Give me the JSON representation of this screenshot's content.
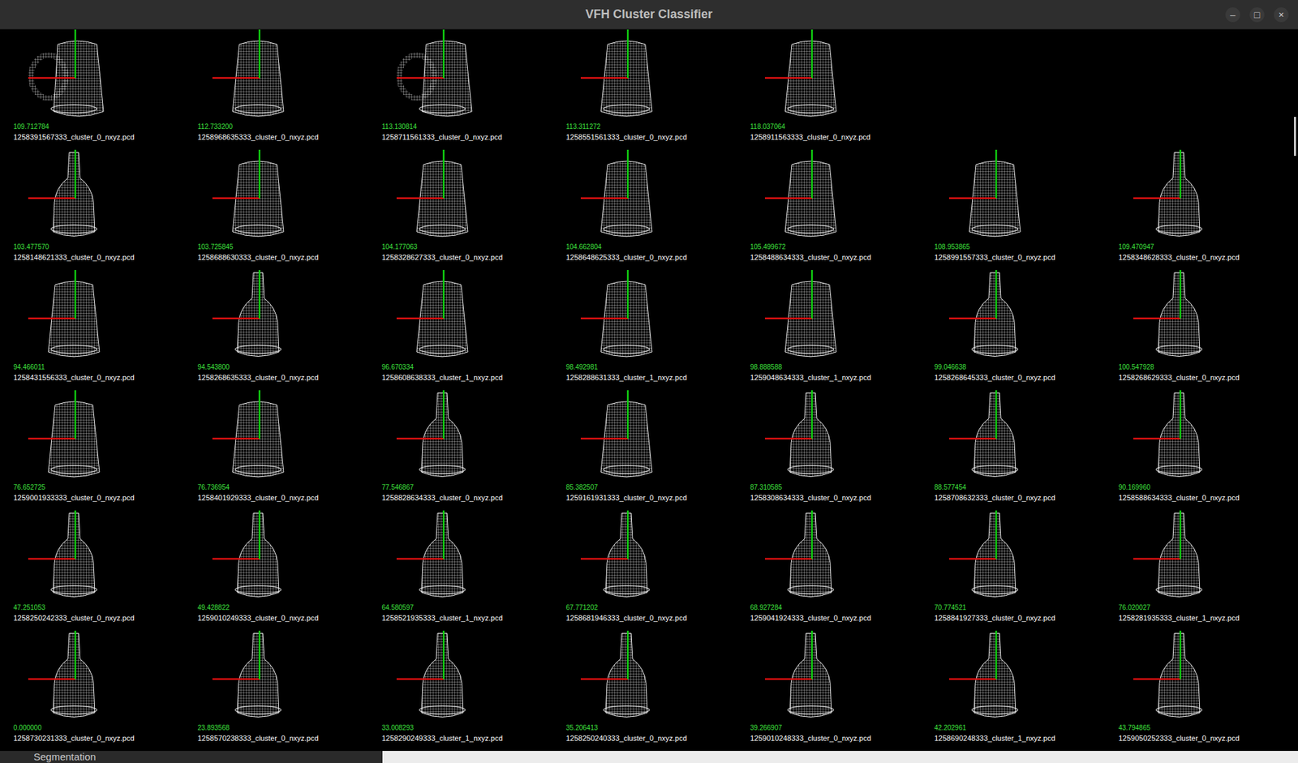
{
  "window": {
    "title": "VFH Cluster Classifier",
    "controls": [
      "–",
      "□",
      "×"
    ]
  },
  "results": [
    [
      {
        "score": "109.712784",
        "file": "1258391567333_cluster_0_nxyz.pcd",
        "kind": "mug"
      },
      {
        "score": "112.733200",
        "file": "1258968635333_cluster_0_nxyz.pcd",
        "kind": "box"
      },
      {
        "score": "113.130814",
        "file": "1258711561333_cluster_0_nxyz.pcd",
        "kind": "mug"
      },
      {
        "score": "113.311272",
        "file": "1258551561333_cluster_0_nxyz.pcd",
        "kind": "box"
      },
      {
        "score": "118.037064",
        "file": "1258911563333_cluster_0_nxyz.pcd",
        "kind": "box"
      }
    ],
    [
      {
        "score": "103.477570",
        "file": "1258148621333_cluster_0_nxyz.pcd",
        "kind": "bottle"
      },
      {
        "score": "103.725845",
        "file": "1258688630333_cluster_0_nxyz.pcd",
        "kind": "box"
      },
      {
        "score": "104.177063",
        "file": "1258328627333_cluster_0_nxyz.pcd",
        "kind": "box"
      },
      {
        "score": "104.662804",
        "file": "1258648625333_cluster_0_nxyz.pcd",
        "kind": "box"
      },
      {
        "score": "105.499672",
        "file": "1258488634333_cluster_0_nxyz.pcd",
        "kind": "box"
      },
      {
        "score": "108.953865",
        "file": "1258991557333_cluster_0_nxyz.pcd",
        "kind": "box"
      },
      {
        "score": "109.470947",
        "file": "1258348628333_cluster_0_nxyz.pcd",
        "kind": "bottle"
      }
    ],
    [
      {
        "score": "94.466011",
        "file": "1258431556333_cluster_0_nxyz.pcd",
        "kind": "box"
      },
      {
        "score": "94.543800",
        "file": "1258268635333_cluster_0_nxyz.pcd",
        "kind": "bottle"
      },
      {
        "score": "96.670334",
        "file": "1258608638333_cluster_1_nxyz.pcd",
        "kind": "box"
      },
      {
        "score": "98.492981",
        "file": "1258288631333_cluster_1_nxyz.pcd",
        "kind": "box"
      },
      {
        "score": "98.888588",
        "file": "1259048634333_cluster_1_nxyz.pcd",
        "kind": "box"
      },
      {
        "score": "99.046638",
        "file": "1258268645333_cluster_0_nxyz.pcd",
        "kind": "bottle"
      },
      {
        "score": "100.547928",
        "file": "1258268629333_cluster_0_nxyz.pcd",
        "kind": "bottle"
      }
    ],
    [
      {
        "score": "76.652725",
        "file": "1259001933333_cluster_0_nxyz.pcd",
        "kind": "box"
      },
      {
        "score": "76.736954",
        "file": "1258401929333_cluster_0_nxyz.pcd",
        "kind": "box"
      },
      {
        "score": "77.546867",
        "file": "1258828634333_cluster_0_nxyz.pcd",
        "kind": "bottle"
      },
      {
        "score": "85.382507",
        "file": "1259161931333_cluster_0_nxyz.pcd",
        "kind": "box"
      },
      {
        "score": "87.310585",
        "file": "1258308634333_cluster_0_nxyz.pcd",
        "kind": "bottle"
      },
      {
        "score": "88.577454",
        "file": "1258708632333_cluster_0_nxyz.pcd",
        "kind": "bottle"
      },
      {
        "score": "90.169960",
        "file": "1258588634333_cluster_0_nxyz.pcd",
        "kind": "bottle"
      }
    ],
    [
      {
        "score": "47.251053",
        "file": "1258250242333_cluster_0_nxyz.pcd",
        "kind": "bottle"
      },
      {
        "score": "49.428822",
        "file": "1259010249333_cluster_0_nxyz.pcd",
        "kind": "bottle"
      },
      {
        "score": "64.580597",
        "file": "1258521935333_cluster_1_nxyz.pcd",
        "kind": "bottle"
      },
      {
        "score": "67.771202",
        "file": "1258681946333_cluster_0_nxyz.pcd",
        "kind": "bottle"
      },
      {
        "score": "68.927284",
        "file": "1259041924333_cluster_0_nxyz.pcd",
        "kind": "bottle"
      },
      {
        "score": "70.774521",
        "file": "1258841927333_cluster_0_nxyz.pcd",
        "kind": "bottle"
      },
      {
        "score": "76.020027",
        "file": "1258281935333_cluster_1_nxyz.pcd",
        "kind": "bottle"
      }
    ],
    [
      {
        "score": "0.000000",
        "file": "1258730231333_cluster_0_nxyz.pcd",
        "kind": "bottle"
      },
      {
        "score": "23.893568",
        "file": "1258570238333_cluster_0_nxyz.pcd",
        "kind": "bottle"
      },
      {
        "score": "33.008293",
        "file": "1258290249333_cluster_1_nxyz.pcd",
        "kind": "bottle"
      },
      {
        "score": "35.206413",
        "file": "1258250240333_cluster_0_nxyz.pcd",
        "kind": "bottle"
      },
      {
        "score": "39.266907",
        "file": "1259010248333_cluster_0_nxyz.pcd",
        "kind": "bottle"
      },
      {
        "score": "42.202961",
        "file": "1258690248333_cluster_1_nxyz.pcd",
        "kind": "bottle"
      },
      {
        "score": "43.794865",
        "file": "1259050252333_cluster_0_nxyz.pcd",
        "kind": "bottle"
      }
    ]
  ],
  "status_bar": {
    "tab": "Segmentation"
  }
}
